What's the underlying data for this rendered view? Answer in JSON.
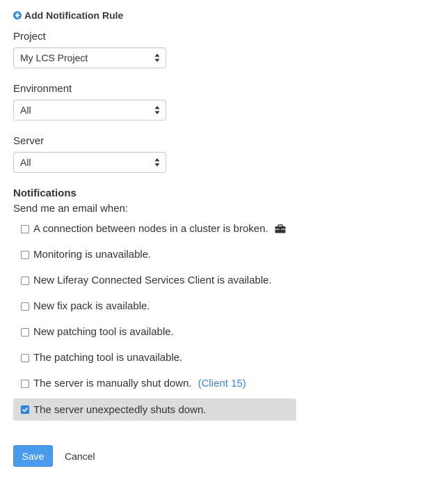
{
  "header": {
    "title": "Add Notification Rule",
    "back_icon": "arrow-circle-left-icon",
    "accent": "#3b86d6"
  },
  "form": {
    "project": {
      "label": "Project",
      "value": "My LCS Project"
    },
    "environment": {
      "label": "Environment",
      "value": "All"
    },
    "server": {
      "label": "Server",
      "value": "All"
    }
  },
  "notifications": {
    "title": "Notifications",
    "subtitle": "Send me an email when:",
    "options": [
      {
        "label": "A connection between nodes in a cluster is broken.",
        "checked": false,
        "icon": "briefcase-icon"
      },
      {
        "label": "Monitoring is unavailable.",
        "checked": false
      },
      {
        "label": "New Liferay Connected Services Client is available.",
        "checked": false
      },
      {
        "label": "New fix pack is available.",
        "checked": false
      },
      {
        "label": "New patching tool is available.",
        "checked": false
      },
      {
        "label": "The patching tool is unavailable.",
        "checked": false
      },
      {
        "label": "The server is manually shut down.",
        "checked": false,
        "link": "(Client 15)"
      },
      {
        "label": "The server unexpectedly shuts down.",
        "checked": true
      }
    ]
  },
  "actions": {
    "save_label": "Save",
    "cancel_label": "Cancel",
    "save_color": "#4a9bed"
  }
}
